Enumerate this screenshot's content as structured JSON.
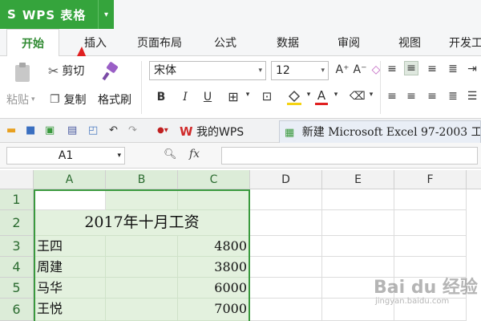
{
  "app": {
    "logo": "S",
    "name": "WPS 表格",
    "dropdown": "▾"
  },
  "tabs": [
    "开始",
    "插入",
    "页面布局",
    "公式",
    "数据",
    "审阅",
    "视图",
    "开发工"
  ],
  "ribbon": {
    "paste_label": "粘贴",
    "cut_label": "剪切",
    "copy_label": "复制",
    "format_painter_label": "格式刷",
    "font_name": "宋体",
    "font_size": "12",
    "grow_font": "A⁺",
    "shrink_font": "A⁻",
    "clear_format": "◇",
    "bold": "B",
    "italic": "I",
    "underline": "U",
    "font_color_letter": "A"
  },
  "quick": {
    "doc_tabs": [
      {
        "label": "我的WPS"
      },
      {
        "label": "新建 Microsoft Excel 97-2003 工"
      }
    ]
  },
  "formula_bar": {
    "name_box": "A1",
    "fx": "fx",
    "value": ""
  },
  "sheet": {
    "columns": [
      "A",
      "B",
      "C",
      "D",
      "E",
      "F"
    ],
    "rows": [
      "1",
      "2",
      "3",
      "4",
      "5",
      "6"
    ],
    "title": "2017年十月工资",
    "data": [
      {
        "name": "王四",
        "amount": "4800"
      },
      {
        "name": "周建",
        "amount": "3800"
      },
      {
        "name": "马华",
        "amount": "6000"
      },
      {
        "name": "王悦",
        "amount": "7000"
      }
    ]
  },
  "colors": {
    "accent": "#35a43c",
    "selection": "#e3f1de"
  },
  "watermark": {
    "brand": "Bai du 经验",
    "url": "jingyan.baidu.com"
  }
}
